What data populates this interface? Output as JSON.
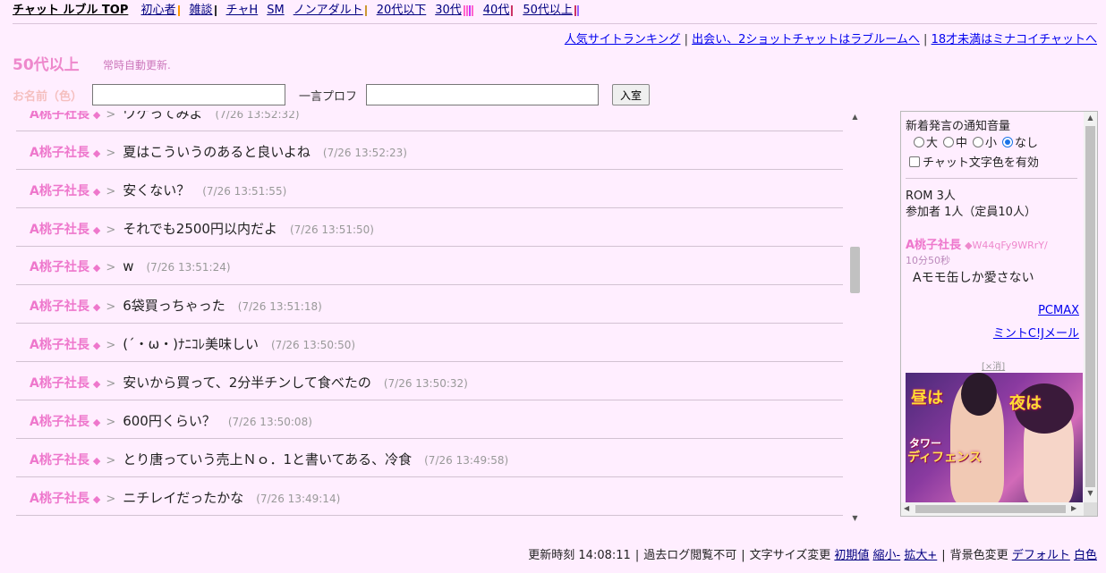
{
  "nav": {
    "brand": "チャット ルブル TOP",
    "items": [
      {
        "label": "初心者",
        "colors": [
          "#ff9900"
        ]
      },
      {
        "label": "雑談",
        "colors": [
          "#333333"
        ]
      },
      {
        "label": "チャH",
        "colors": []
      },
      {
        "label": "SM",
        "colors": []
      },
      {
        "label": "ノンアダルト",
        "colors": [
          "#cc9933"
        ]
      },
      {
        "label": "20代以下",
        "colors": []
      },
      {
        "label": "30代",
        "colors": [
          "#ff66cc",
          "#ff66cc",
          "#cc33ff",
          "#ff66cc"
        ]
      },
      {
        "label": "40代",
        "colors": [
          "#cc3366"
        ]
      },
      {
        "label": "50代以上",
        "colors": [
          "#cc3366",
          "#9966ff"
        ]
      }
    ]
  },
  "right_links": {
    "ranking": "人気サイトランキング",
    "loveroom": "出会い、2ショットチャットはラブルームへ",
    "minako": "18才未満はミナコイチャットへ",
    "separator": "|"
  },
  "room": {
    "title": "50代以上",
    "auto_update": "常時自動更新."
  },
  "form": {
    "name_label": "お名前（色）",
    "name_value": "",
    "profile_label": "一言プロフ",
    "profile_value": "",
    "enter_label": "入室"
  },
  "messages": [
    {
      "name": "A桃子社長",
      "diamond": "◆",
      "gt": ">",
      "text": "ワケってみよ",
      "time": "(7/26 13:52:32)"
    },
    {
      "name": "A桃子社長",
      "diamond": "◆",
      "gt": ">",
      "text": "夏はこういうのあると良いよね",
      "time": "(7/26 13:52:23)"
    },
    {
      "name": "A桃子社長",
      "diamond": "◆",
      "gt": ">",
      "text": "安くない？",
      "time": "(7/26 13:51:55)"
    },
    {
      "name": "A桃子社長",
      "diamond": "◆",
      "gt": ">",
      "text": "それでも2500円以内だよ",
      "time": "(7/26 13:51:50)"
    },
    {
      "name": "A桃子社長",
      "diamond": "◆",
      "gt": ">",
      "text": "w",
      "time": "(7/26 13:51:24)"
    },
    {
      "name": "A桃子社長",
      "diamond": "◆",
      "gt": ">",
      "text": "6袋買っちゃった",
      "time": "(7/26 13:51:18)"
    },
    {
      "name": "A桃子社長",
      "diamond": "◆",
      "gt": ">",
      "text": "(´・ω・)ﾅﾆｺﾚ美味しい",
      "time": "(7/26 13:50:50)"
    },
    {
      "name": "A桃子社長",
      "diamond": "◆",
      "gt": ">",
      "text": "安いから買って、2分半チンして食べたの",
      "time": "(7/26 13:50:32)"
    },
    {
      "name": "A桃子社長",
      "diamond": "◆",
      "gt": ">",
      "text": "600円くらい？",
      "time": "(7/26 13:50:08)"
    },
    {
      "name": "A桃子社長",
      "diamond": "◆",
      "gt": ">",
      "text": "とり唐っていう売上Ｎｏ．1と書いてある、冷食",
      "time": "(7/26 13:49:58)"
    },
    {
      "name": "A桃子社長",
      "diamond": "◆",
      "gt": ">",
      "text": "ニチレイだったかな",
      "time": "(7/26 13:49:14)"
    }
  ],
  "side": {
    "sound_title": "新着発言の通知音量",
    "sound_options": [
      {
        "label": "大",
        "checked": false
      },
      {
        "label": "中",
        "checked": false
      },
      {
        "label": "小",
        "checked": false
      },
      {
        "label": "なし",
        "checked": true
      }
    ],
    "color_checkbox_label": "チャット文字色を有効",
    "rom": "ROM 3人",
    "participants": "参加者 1人（定員10人）",
    "member": {
      "name": "A桃子社長",
      "trip": "◆W44qFy9WRrY/",
      "elapsed": "10分50秒",
      "profile": "Aモモ缶しか愛さない"
    },
    "links": [
      "PCMAX",
      "ミントC!Jメール"
    ],
    "close_ad": "[×消]",
    "ad": {
      "word1": "昼は",
      "word2": "夜は",
      "word3": "タワー",
      "word4": "ディフェンス"
    }
  },
  "footer": {
    "update_time": "更新時刻 14:08:11",
    "log": "過去ログ閲覧不可",
    "font_size_label": "文字サイズ変更",
    "font_default": "初期値",
    "font_smaller": "縮小-",
    "font_larger": "拡大+",
    "bg_label": "背景色変更",
    "bg_default": "デフォルト",
    "bg_white": "白色",
    "separator": "|"
  }
}
